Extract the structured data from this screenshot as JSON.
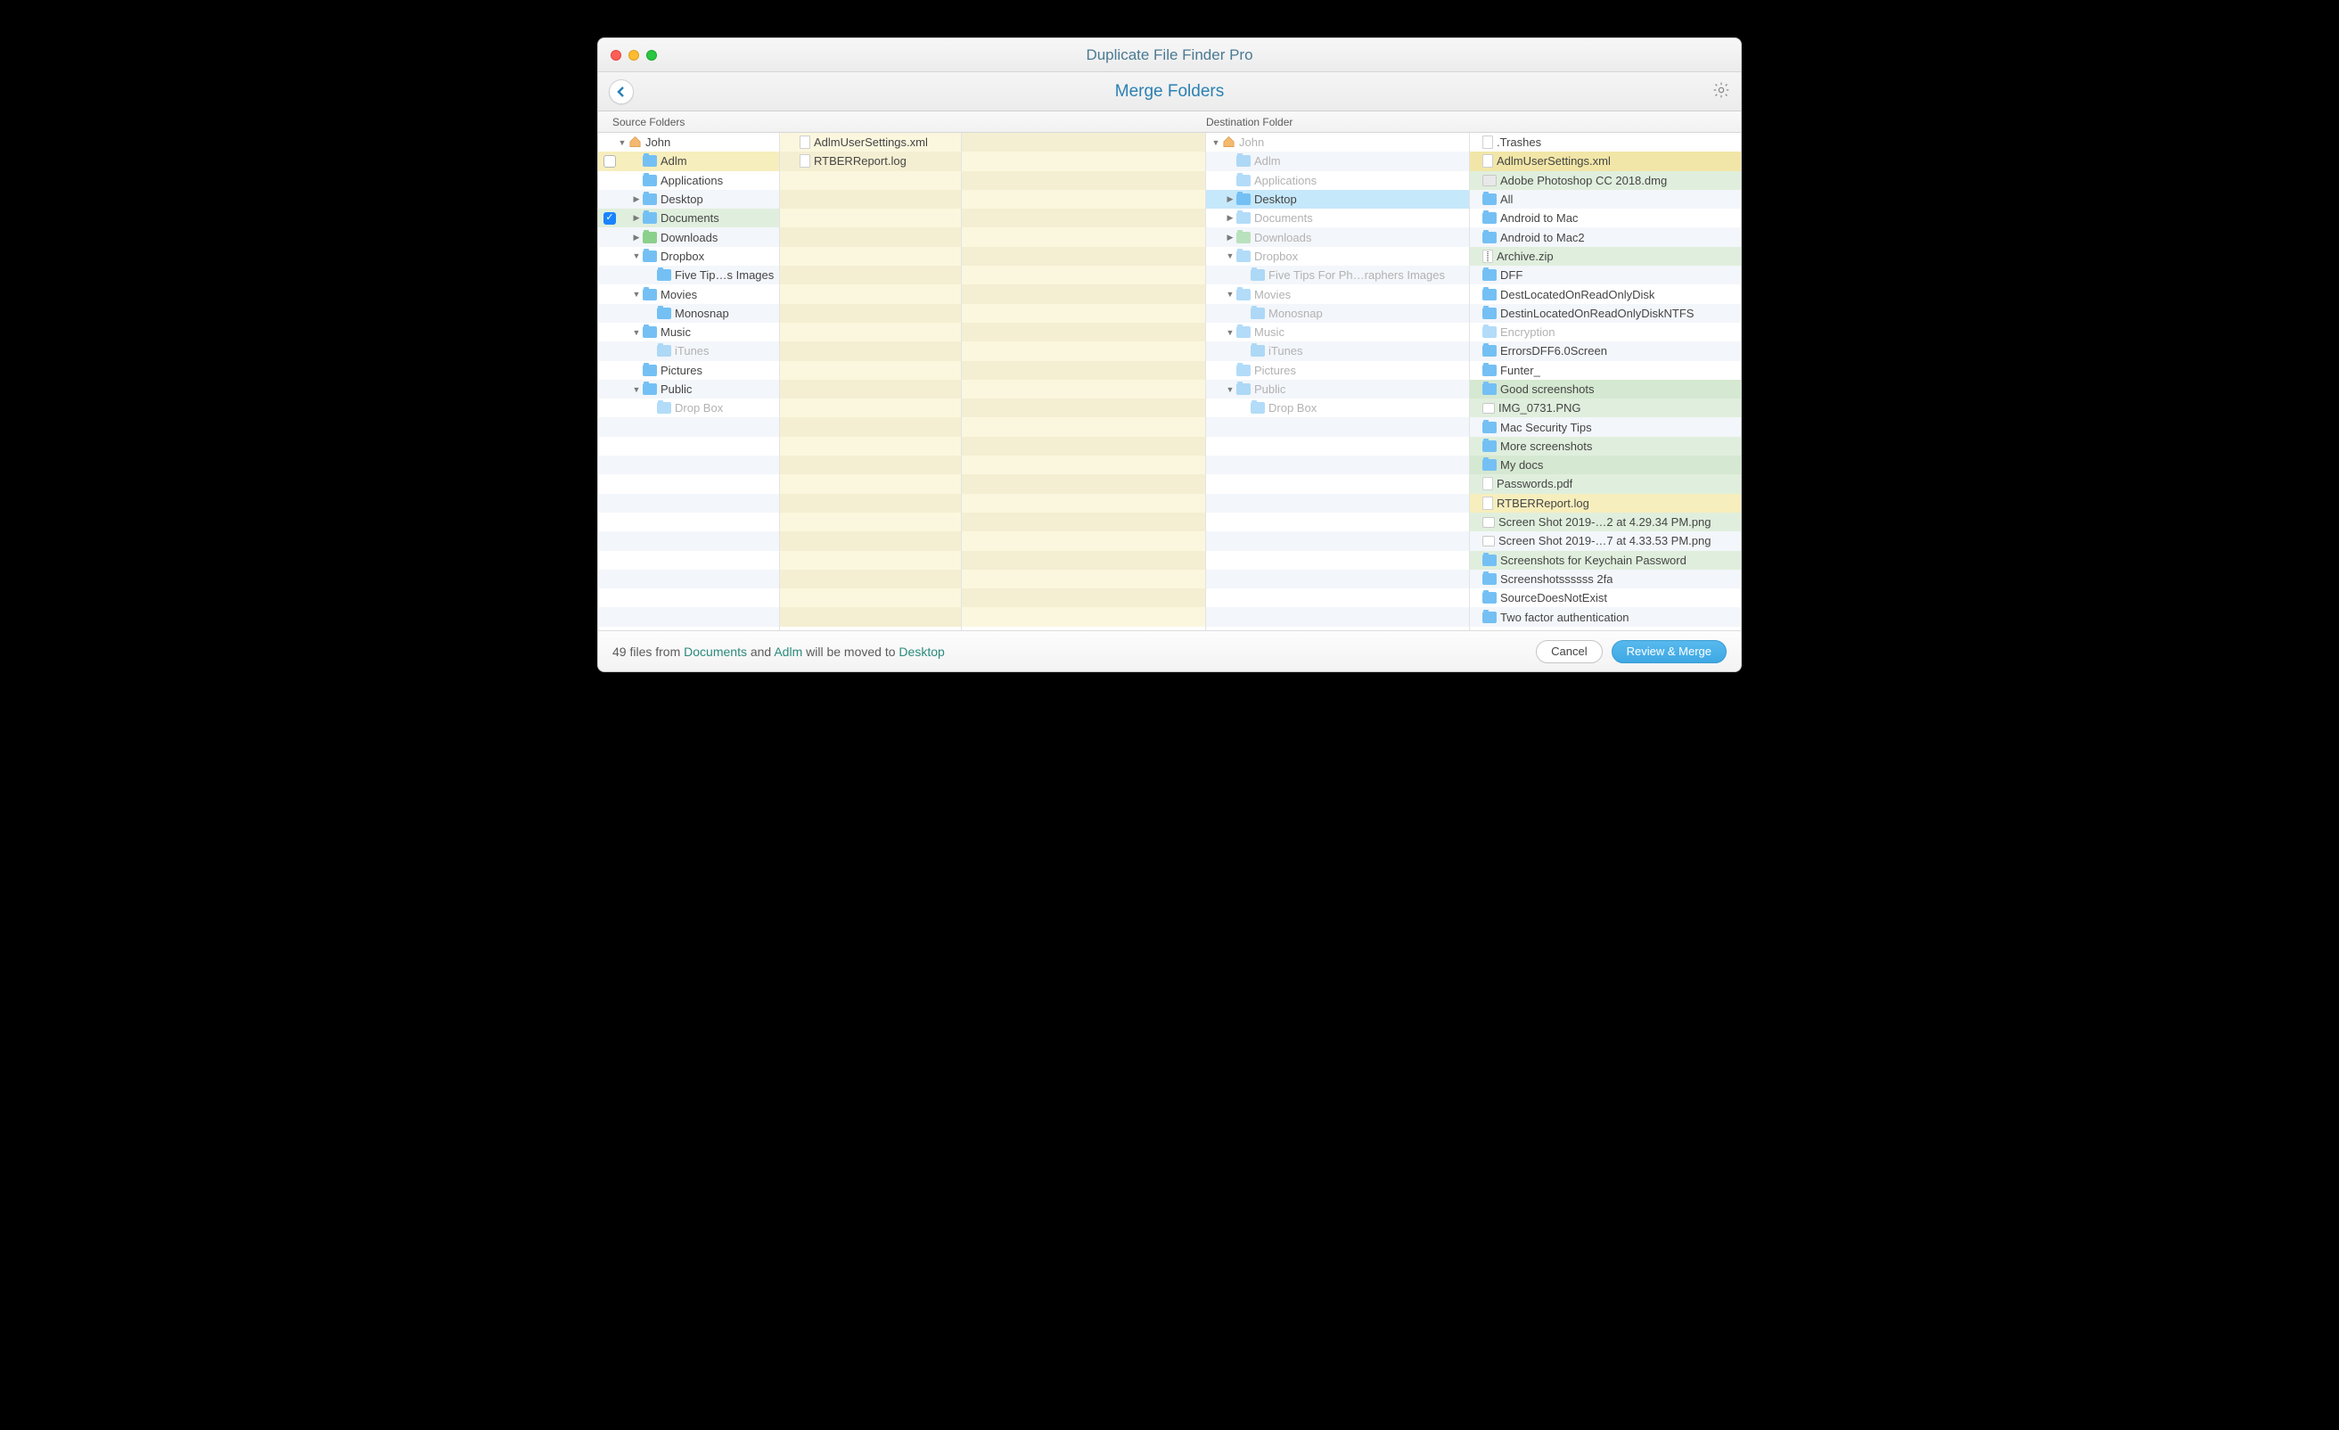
{
  "window": {
    "title": "Duplicate File Finder Pro"
  },
  "toolbar": {
    "title": "Merge Folders"
  },
  "headers": {
    "source": "Source Folders",
    "destination": "Destination Folder"
  },
  "source_tree": [
    {
      "depth": 0,
      "disclosure": "down",
      "checkbox": null,
      "icon": "home",
      "label": "John",
      "hi": ""
    },
    {
      "depth": 1,
      "disclosure": "",
      "checkbox": "off",
      "icon": "folder",
      "label": "Adlm",
      "hi": "hi-yellow-l"
    },
    {
      "depth": 1,
      "disclosure": "",
      "checkbox": null,
      "icon": "folder",
      "label": "Applications",
      "hi": ""
    },
    {
      "depth": 1,
      "disclosure": "right",
      "checkbox": null,
      "icon": "folder",
      "label": "Desktop",
      "hi": ""
    },
    {
      "depth": 1,
      "disclosure": "right",
      "checkbox": "on",
      "icon": "folder",
      "label": "Documents",
      "hi": "hi-green-l"
    },
    {
      "depth": 1,
      "disclosure": "right",
      "checkbox": null,
      "icon": "folder-green",
      "label": "Downloads",
      "hi": ""
    },
    {
      "depth": 1,
      "disclosure": "down",
      "checkbox": null,
      "icon": "folder",
      "label": "Dropbox",
      "hi": ""
    },
    {
      "depth": 2,
      "disclosure": "",
      "checkbox": null,
      "icon": "folder",
      "label": "Five Tip…s Images",
      "hi": ""
    },
    {
      "depth": 1,
      "disclosure": "down",
      "checkbox": null,
      "icon": "folder",
      "label": "Movies",
      "hi": ""
    },
    {
      "depth": 2,
      "disclosure": "",
      "checkbox": null,
      "icon": "folder",
      "label": "Monosnap",
      "hi": ""
    },
    {
      "depth": 1,
      "disclosure": "down",
      "checkbox": null,
      "icon": "folder",
      "label": "Music",
      "hi": ""
    },
    {
      "depth": 2,
      "disclosure": "",
      "checkbox": null,
      "icon": "folder",
      "label": "iTunes",
      "hi": "",
      "faded": true
    },
    {
      "depth": 1,
      "disclosure": "",
      "checkbox": null,
      "icon": "folder",
      "label": "Pictures",
      "hi": ""
    },
    {
      "depth": 1,
      "disclosure": "down",
      "checkbox": null,
      "icon": "folder",
      "label": "Public",
      "hi": ""
    },
    {
      "depth": 2,
      "disclosure": "",
      "checkbox": null,
      "icon": "folder",
      "label": "Drop Box",
      "hi": "",
      "faded": true
    }
  ],
  "source_files": [
    {
      "icon": "file",
      "label": "AdlmUserSettings.xml"
    },
    {
      "icon": "file",
      "label": "RTBERReport.log"
    }
  ],
  "dest_tree": [
    {
      "depth": 0,
      "disclosure": "down",
      "icon": "home",
      "label": "John",
      "hi": "",
      "faded": true
    },
    {
      "depth": 1,
      "disclosure": "",
      "icon": "folder",
      "label": "Adlm",
      "hi": "",
      "faded": true
    },
    {
      "depth": 1,
      "disclosure": "",
      "icon": "folder",
      "label": "Applications",
      "hi": "",
      "faded": true
    },
    {
      "depth": 1,
      "disclosure": "right",
      "icon": "folder",
      "label": "Desktop",
      "hi": "hi-blue"
    },
    {
      "depth": 1,
      "disclosure": "right",
      "icon": "folder",
      "label": "Documents",
      "hi": "",
      "faded": true
    },
    {
      "depth": 1,
      "disclosure": "right",
      "icon": "folder-green",
      "label": "Downloads",
      "hi": "",
      "faded": true
    },
    {
      "depth": 1,
      "disclosure": "down",
      "icon": "folder",
      "label": "Dropbox",
      "hi": "",
      "faded": true
    },
    {
      "depth": 2,
      "disclosure": "",
      "icon": "folder",
      "label": "Five Tips For Ph…raphers Images",
      "hi": "",
      "faded": true
    },
    {
      "depth": 1,
      "disclosure": "down",
      "icon": "folder",
      "label": "Movies",
      "hi": "",
      "faded": true
    },
    {
      "depth": 2,
      "disclosure": "",
      "icon": "folder",
      "label": "Monosnap",
      "hi": "",
      "faded": true
    },
    {
      "depth": 1,
      "disclosure": "down",
      "icon": "folder",
      "label": "Music",
      "hi": "",
      "faded": true
    },
    {
      "depth": 2,
      "disclosure": "",
      "icon": "folder",
      "label": "iTunes",
      "hi": "",
      "faded": true
    },
    {
      "depth": 1,
      "disclosure": "",
      "icon": "folder",
      "label": "Pictures",
      "hi": "",
      "faded": true
    },
    {
      "depth": 1,
      "disclosure": "down",
      "icon": "folder",
      "label": "Public",
      "hi": "",
      "faded": true
    },
    {
      "depth": 2,
      "disclosure": "",
      "icon": "folder",
      "label": "Drop Box",
      "hi": "",
      "faded": true
    }
  ],
  "dest_files": [
    {
      "icon": "file",
      "label": ".Trashes",
      "hi": ""
    },
    {
      "icon": "file",
      "label": "AdlmUserSettings.xml",
      "hi": "hi-yellow-d"
    },
    {
      "icon": "dmg",
      "label": "Adobe Photoshop CC 2018.dmg",
      "hi": "hi-green-l"
    },
    {
      "icon": "folder",
      "label": "All",
      "hi": ""
    },
    {
      "icon": "folder",
      "label": "Android to Mac",
      "hi": ""
    },
    {
      "icon": "folder",
      "label": "Android to Mac2",
      "hi": ""
    },
    {
      "icon": "zip",
      "label": "Archive.zip",
      "hi": "hi-green-l"
    },
    {
      "icon": "folder",
      "label": "DFF",
      "hi": ""
    },
    {
      "icon": "folder",
      "label": "DestLocatedOnReadOnlyDisk",
      "hi": ""
    },
    {
      "icon": "folder",
      "label": "DestinLocatedOnReadOnlyDiskNTFS",
      "hi": ""
    },
    {
      "icon": "folder",
      "label": "Encryption",
      "hi": "",
      "faded": true
    },
    {
      "icon": "folder",
      "label": "ErrorsDFF6.0Screen",
      "hi": ""
    },
    {
      "icon": "folder",
      "label": "Funter_",
      "hi": ""
    },
    {
      "icon": "folder",
      "label": "Good screenshots",
      "hi": "hi-green-d"
    },
    {
      "icon": "img",
      "label": "IMG_0731.PNG",
      "hi": "hi-green-l"
    },
    {
      "icon": "folder",
      "label": "Mac Security Tips",
      "hi": ""
    },
    {
      "icon": "folder",
      "label": "More screenshots",
      "hi": "hi-green-l"
    },
    {
      "icon": "folder",
      "label": "My docs",
      "hi": "hi-green-d"
    },
    {
      "icon": "pdf",
      "label": "Passwords.pdf",
      "hi": "hi-green-l"
    },
    {
      "icon": "file",
      "label": "RTBERReport.log",
      "hi": "hi-yellow-l"
    },
    {
      "icon": "img",
      "label": "Screen Shot 2019-…2 at 4.29.34 PM.png",
      "hi": "hi-green-l"
    },
    {
      "icon": "img",
      "label": "Screen Shot 2019-…7 at 4.33.53 PM.png",
      "hi": ""
    },
    {
      "icon": "folder",
      "label": "Screenshots for Keychain Password",
      "hi": "hi-green-l"
    },
    {
      "icon": "folder",
      "label": "Screenshotssssss 2fa",
      "hi": ""
    },
    {
      "icon": "folder",
      "label": "SourceDoesNotExist",
      "hi": ""
    },
    {
      "icon": "folder",
      "label": "Two factor authentication",
      "hi": ""
    }
  ],
  "footer": {
    "count": "49",
    "t1": " files from ",
    "src1": "Documents",
    "and": " and ",
    "src2": "Adlm",
    "t2": " will be moved to ",
    "dest": "Desktop",
    "cancel": "Cancel",
    "merge": "Review & Merge"
  }
}
